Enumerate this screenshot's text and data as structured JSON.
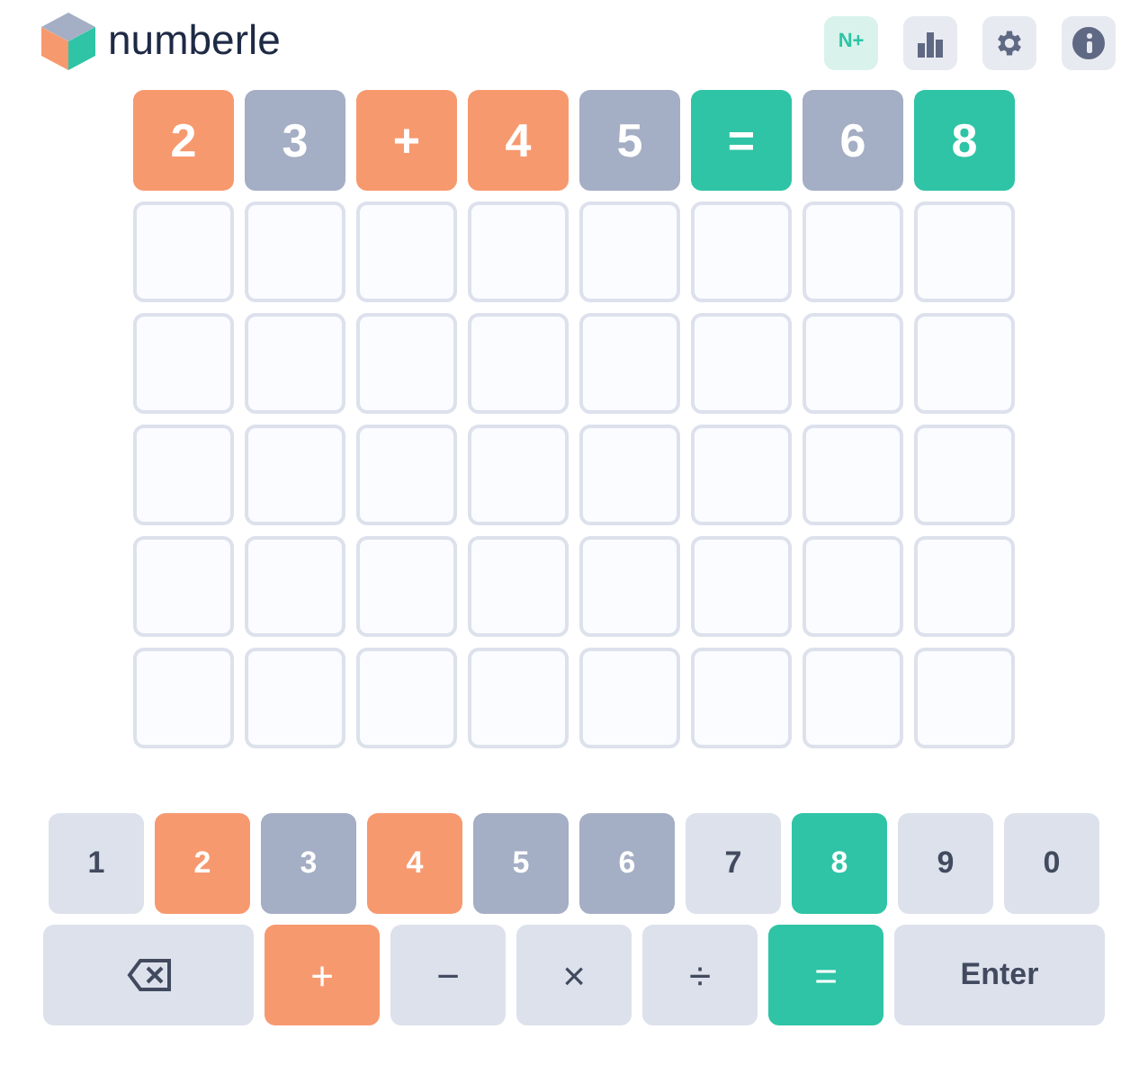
{
  "header": {
    "title": "numberle",
    "buttons": [
      {
        "kind": "text",
        "label": "N+"
      },
      {
        "kind": "stats"
      },
      {
        "kind": "settings"
      },
      {
        "kind": "info"
      }
    ]
  },
  "board": {
    "rows": [
      [
        {
          "char": "2",
          "filled": true,
          "color": "#f7996e"
        },
        {
          "char": "3",
          "filled": true,
          "color": "#a4aec4"
        },
        {
          "char": "+",
          "filled": true,
          "color": "#f7996e"
        },
        {
          "char": "4",
          "filled": true,
          "color": "#f7996e"
        },
        {
          "char": "5",
          "filled": true,
          "color": "#a4aec4"
        },
        {
          "char": "=",
          "filled": true,
          "color": "#2ec4a5"
        },
        {
          "char": "6",
          "filled": true,
          "color": "#a4aec4"
        },
        {
          "char": "8",
          "filled": true,
          "color": "#2ec4a5"
        }
      ],
      [
        {
          "filled": false
        },
        {
          "filled": false
        },
        {
          "filled": false
        },
        {
          "filled": false
        },
        {
          "filled": false
        },
        {
          "filled": false
        },
        {
          "filled": false
        },
        {
          "filled": false
        }
      ],
      [
        {
          "filled": false
        },
        {
          "filled": false
        },
        {
          "filled": false
        },
        {
          "filled": false
        },
        {
          "filled": false
        },
        {
          "filled": false
        },
        {
          "filled": false
        },
        {
          "filled": false
        }
      ],
      [
        {
          "filled": false
        },
        {
          "filled": false
        },
        {
          "filled": false
        },
        {
          "filled": false
        },
        {
          "filled": false
        },
        {
          "filled": false
        },
        {
          "filled": false
        },
        {
          "filled": false
        }
      ],
      [
        {
          "filled": false
        },
        {
          "filled": false
        },
        {
          "filled": false
        },
        {
          "filled": false
        },
        {
          "filled": false
        },
        {
          "filled": false
        },
        {
          "filled": false
        },
        {
          "filled": false
        }
      ],
      [
        {
          "filled": false
        },
        {
          "filled": false
        },
        {
          "filled": false
        },
        {
          "filled": false
        },
        {
          "filled": false
        },
        {
          "filled": false
        },
        {
          "filled": false
        },
        {
          "filled": false
        }
      ]
    ]
  },
  "keyboard": {
    "rows": [
      [
        {
          "kind": "digit",
          "label": "1",
          "used": false
        },
        {
          "kind": "digit",
          "label": "2",
          "used": true,
          "color": "#f7996e"
        },
        {
          "kind": "digit",
          "label": "3",
          "used": true,
          "color": "#a4aec4"
        },
        {
          "kind": "digit",
          "label": "4",
          "used": true,
          "color": "#f7996e"
        },
        {
          "kind": "digit",
          "label": "5",
          "used": true,
          "color": "#a4aec4"
        },
        {
          "kind": "digit",
          "label": "6",
          "used": true,
          "color": "#a4aec4"
        },
        {
          "kind": "digit",
          "label": "7",
          "used": false
        },
        {
          "kind": "digit",
          "label": "8",
          "used": true,
          "color": "#2ec4a5"
        },
        {
          "kind": "digit",
          "label": "9",
          "used": false
        },
        {
          "kind": "digit",
          "label": "0",
          "used": false
        }
      ],
      [
        {
          "kind": "backspace",
          "used": false
        },
        {
          "kind": "operator",
          "label": "+",
          "used": true,
          "color": "#f7996e"
        },
        {
          "kind": "operator",
          "label": "−",
          "used": false
        },
        {
          "kind": "operator",
          "label": "×",
          "used": false
        },
        {
          "kind": "operator",
          "label": "÷",
          "used": false
        },
        {
          "kind": "operator",
          "label": "=",
          "used": true,
          "color": "#2ec4a5"
        },
        {
          "kind": "wide",
          "label": "Enter",
          "used": false
        }
      ]
    ]
  }
}
